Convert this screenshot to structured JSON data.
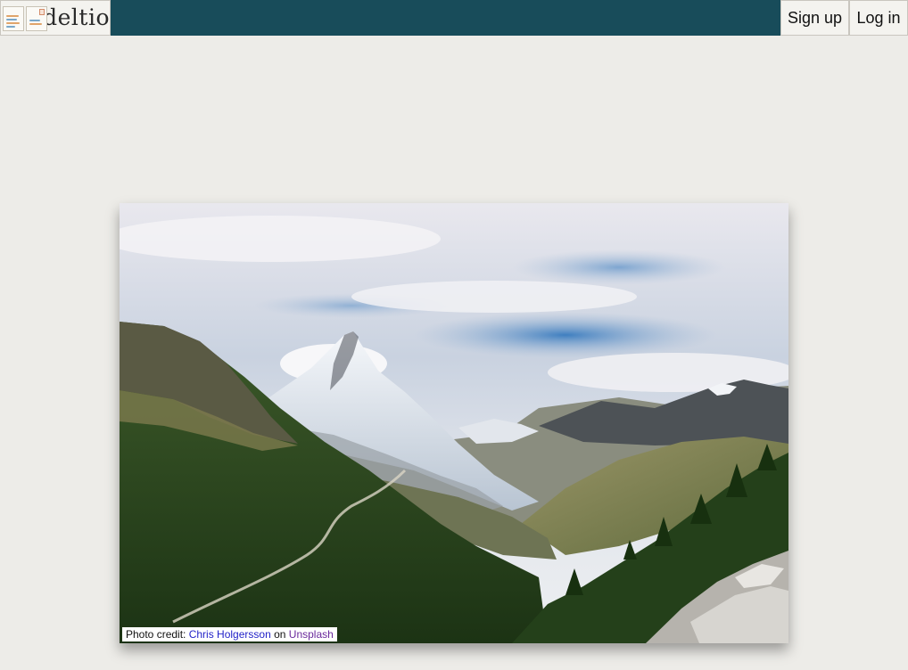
{
  "header": {
    "brand_name": "deltio",
    "brand_icon": "postcard-icon",
    "signup_label": "Sign up",
    "login_label": "Log in"
  },
  "colors": {
    "header_bg": "#184c5a",
    "page_bg": "#edece8",
    "button_bg": "#f4f3ef",
    "link_author": "#2323c8",
    "link_site": "#6a2a9c"
  },
  "hero": {
    "photo_subject": "mountain-landscape-image",
    "credit_prefix": "Photo credit: ",
    "credit_author": "Chris Holgersson",
    "credit_on": " on ",
    "credit_site": "Unsplash"
  }
}
